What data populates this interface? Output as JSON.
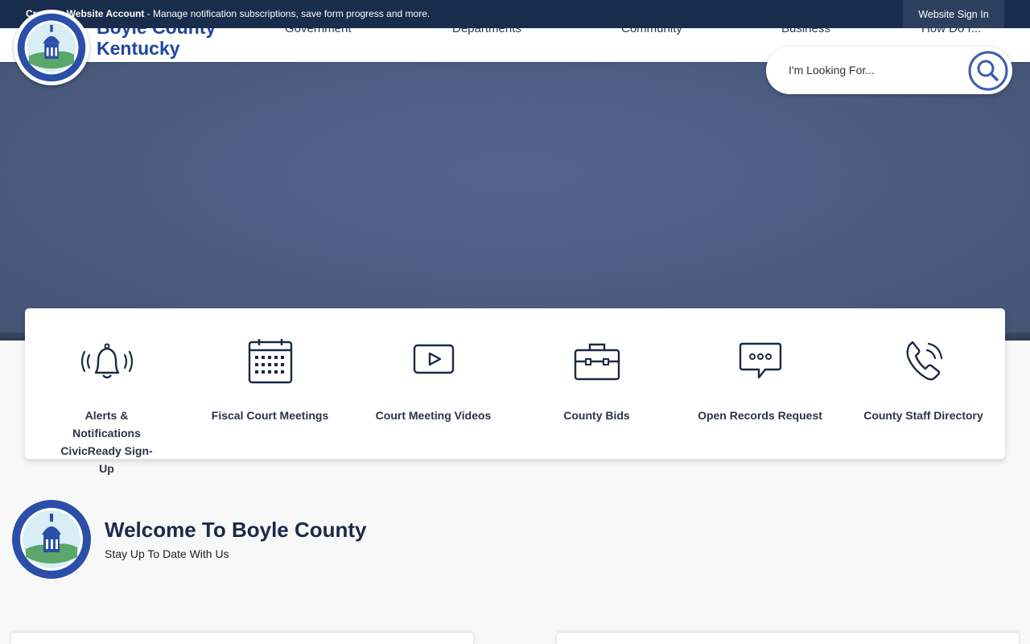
{
  "topbar": {
    "account_link": "Create a Website Account",
    "account_message": " - Manage notification subscriptions, save form progress and more.",
    "signin_label": "Website Sign In"
  },
  "header": {
    "site_name_line1": "Boyle County",
    "site_name_line2": "Kentucky",
    "nav": [
      {
        "label": "Government"
      },
      {
        "label": "Departments"
      },
      {
        "label": "Community"
      },
      {
        "label": "Business"
      },
      {
        "label": "How Do I..."
      }
    ]
  },
  "search": {
    "placeholder": "I'm Looking For..."
  },
  "quick_links": [
    {
      "label": "Alerts & Notifications CivicReady Sign-Up",
      "icon": "bell-icon"
    },
    {
      "label": "Fiscal Court Meetings",
      "icon": "calendar-icon"
    },
    {
      "label": "Court Meeting Videos",
      "icon": "video-play-icon"
    },
    {
      "label": "County Bids",
      "icon": "briefcase-icon"
    },
    {
      "label": "Open Records Request",
      "icon": "chat-bubble-icon"
    },
    {
      "label": "County Staff Directory",
      "icon": "phone-icon"
    }
  ],
  "welcome": {
    "title": "Welcome To Boyle County",
    "subtitle": "Stay Up To Date With Us"
  },
  "colors": {
    "topbar": "#182c4c",
    "brand_blue": "#1f45a0",
    "hero": "#54648f",
    "icon_stroke": "#1b2a44"
  }
}
